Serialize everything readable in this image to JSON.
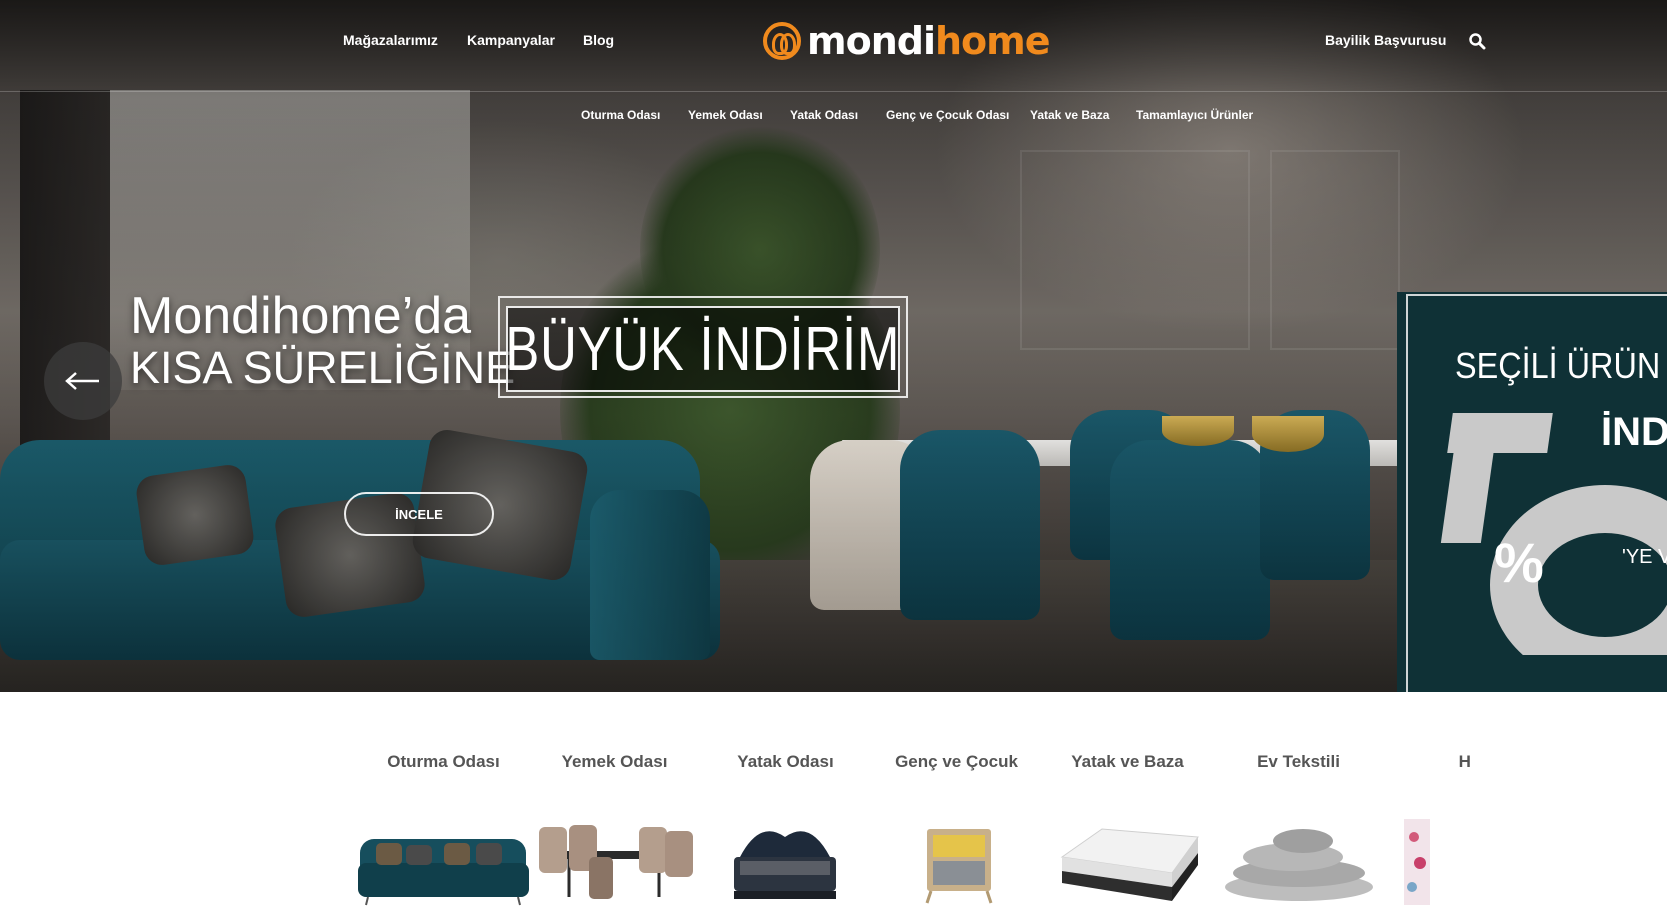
{
  "header": {
    "nav_left": [
      "Mağazalarımız",
      "Kampanyalar",
      "Blog"
    ],
    "logo": {
      "part1": "mondi",
      "part2": "home"
    },
    "nav_right": "Bayilik Başvurusu",
    "search_icon": "search-icon"
  },
  "subnav": [
    "Oturma Odası",
    "Yemek Odası",
    "Yatak Odası",
    "Genç ve Çocuk Odası",
    "Yatak ve Baza",
    "Tamamlayıcı Ürünler"
  ],
  "hero": {
    "line1": "Mondihome’da",
    "line2": "KISA SÜRELİĞİNE",
    "sale": "BÜYÜK İNDİRİM",
    "button": "İNCELE",
    "prev_icon": "arrow-left-icon",
    "next_slide": {
      "title": "SEÇİLİ ÜRÜN",
      "ind": "İND",
      "percent": "%",
      "ye": "'YE V"
    }
  },
  "categories": [
    "Oturma Odası",
    "Yemek Odası",
    "Yatak Odası",
    "Genç ve Çocuk",
    "Yatak ve Baza",
    "Ev Tekstili",
    "Ha"
  ],
  "colors": {
    "brand_orange": "#f08a1d",
    "teal": "#1b5b6d"
  }
}
